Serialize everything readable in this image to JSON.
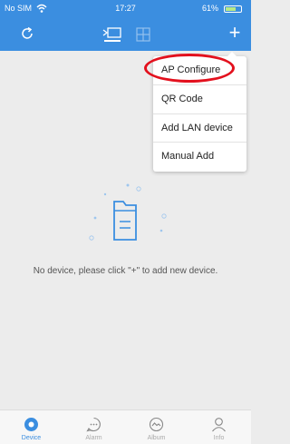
{
  "status_bar": {
    "carrier": "No SIM",
    "time": "17:27",
    "battery": "61%",
    "battery_level": 0.61
  },
  "nav": {
    "add_label": "+",
    "accent_color": "#3b8ee0"
  },
  "menu": {
    "items": [
      {
        "label": "AP Configure"
      },
      {
        "label": "QR Code"
      },
      {
        "label": "Add LAN device"
      },
      {
        "label": "Manual Add"
      }
    ]
  },
  "empty_state": {
    "message": "No device, please click \"+\" to add new device."
  },
  "tabs": [
    {
      "label": "Device",
      "icon": "device-icon",
      "active": true
    },
    {
      "label": "Alarm",
      "icon": "alarm-icon",
      "active": false
    },
    {
      "label": "Album",
      "icon": "album-icon",
      "active": false
    },
    {
      "label": "Info",
      "icon": "info-icon",
      "active": false
    }
  ],
  "highlight_color": "#e3101d"
}
